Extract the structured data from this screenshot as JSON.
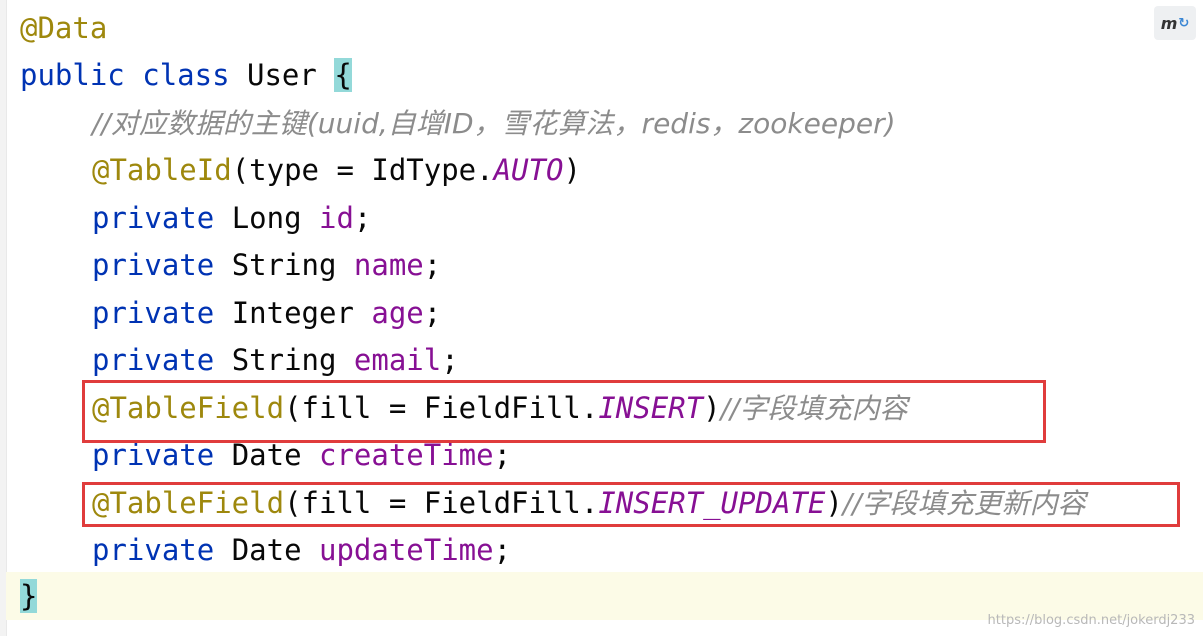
{
  "toolbar": {
    "plugin_icon": "maven-refresh-icon",
    "plugin_label": "m"
  },
  "code": {
    "l1": {
      "annotation": "@Data"
    },
    "l2": {
      "kw1": "public",
      "kw2": "class",
      "name": "User",
      "brace": "{"
    },
    "l3": {
      "comment": "//对应数据的主键(uuid,自增ID，雪花算法，redis，zookeeper)"
    },
    "l4": {
      "annotation": "@TableId",
      "open": "(type = IdType.",
      "constant": "AUTO",
      "close": ")"
    },
    "l5": {
      "kw": "private",
      "type": "Long",
      "field": "id",
      "end": ";"
    },
    "l6": {
      "kw": "private",
      "type": "String",
      "field": "name",
      "end": ";"
    },
    "l7": {
      "kw": "private",
      "type": "Integer",
      "field": "age",
      "end": ";"
    },
    "l8": {
      "kw": "private",
      "type": "String",
      "field": "email",
      "end": ";"
    },
    "l9": {
      "annotation": "@TableField",
      "open": "(fill = FieldFill.",
      "constant": "INSERT",
      "close": ")",
      "comment": "//字段填充内容"
    },
    "l10": {
      "kw": "private",
      "type": "Date",
      "field": "createTime",
      "end": ";"
    },
    "l11": {
      "annotation": "@TableField",
      "open": "(fill = FieldFill.",
      "constant": "INSERT_UPDATE",
      "close": ")",
      "comment": "//字段填充更新内容"
    },
    "l12": {
      "kw": "private",
      "type": "Date",
      "field": "updateTime",
      "end": ";"
    },
    "l13": {
      "brace": "}"
    }
  },
  "colors": {
    "keyword": "#0033b3",
    "annotation": "#9e880d",
    "field": "#871094",
    "comment": "#8c8c8c",
    "highlight_box": "#e03c3c",
    "brace_match": "#93d9d9"
  },
  "watermark": "https://blog.csdn.net/jokerdj233"
}
